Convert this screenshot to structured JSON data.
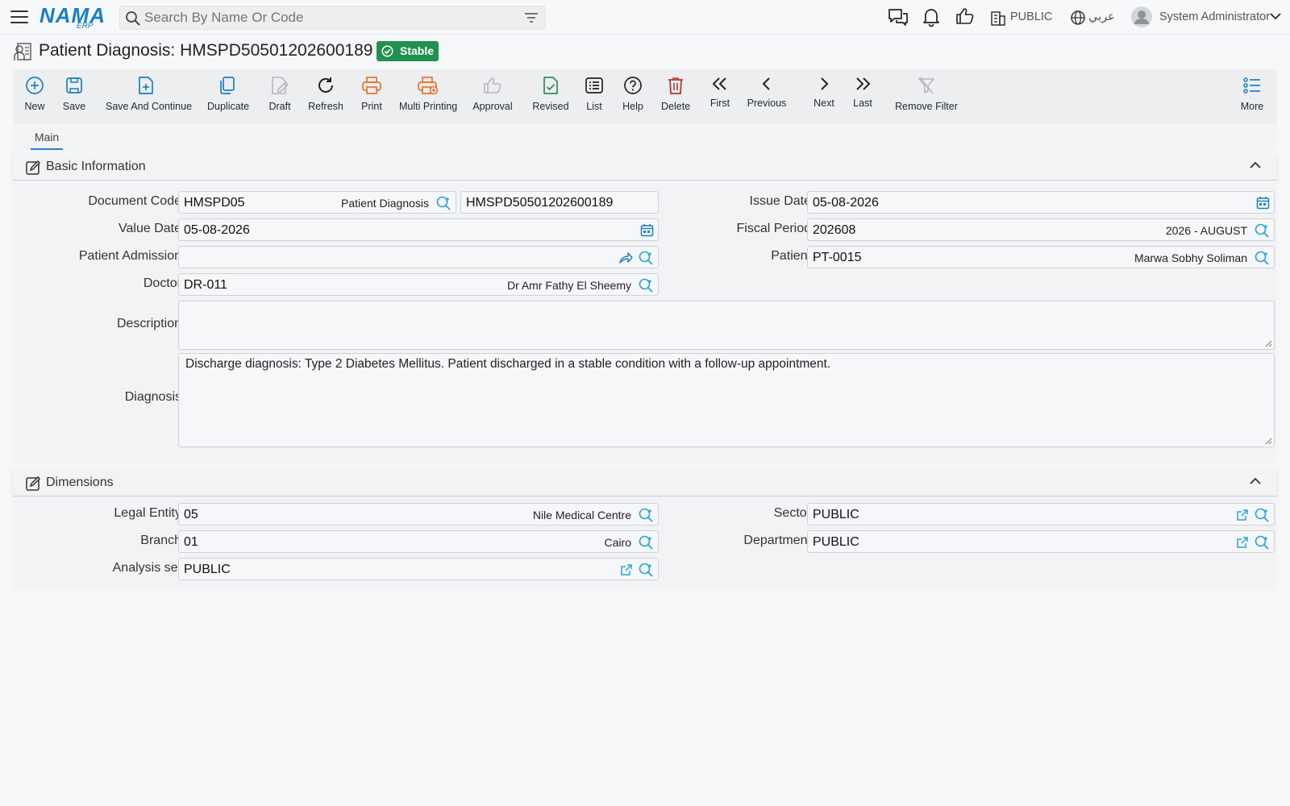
{
  "topbar": {
    "logo": "NAMA",
    "logo_sub": "ERP",
    "search_placeholder": "Search By Name Or Code",
    "company": "PUBLIC",
    "language": "عربي",
    "user": "System Administrator"
  },
  "header": {
    "title": "Patient Diagnosis: HMSPD50501202600189",
    "status": "Stable"
  },
  "toolbar": {
    "new": "New",
    "save": "Save",
    "save_continue": "Save And Continue",
    "duplicate": "Duplicate",
    "draft": "Draft",
    "refresh": "Refresh",
    "print": "Print",
    "multi_printing": "Multi Printing",
    "approval": "Approval",
    "revised": "Revised",
    "list": "List",
    "help": "Help",
    "delete": "Delete",
    "first": "First",
    "previous": "Previous",
    "next": "Next",
    "last": "Last",
    "remove_filter": "Remove Filter",
    "more": "More"
  },
  "tabs": {
    "main": "Main"
  },
  "basic": {
    "title": "Basic Information",
    "document_code_label": "Document Code",
    "document_code": "HMSPD05",
    "document_code_desc": "Patient Diagnosis",
    "document_number": "HMSPD50501202600189",
    "issue_date_label": "Issue Date",
    "issue_date": "05-08-2026",
    "value_date_label": "Value Date",
    "value_date": "05-08-2026",
    "fiscal_period_label": "Fiscal Period",
    "fiscal_period": "202608",
    "fiscal_period_desc": "2026 - AUGUST",
    "patient_admission_label": "Patient Admission",
    "patient_admission": "",
    "patient_label": "Patient",
    "patient": "PT-0015",
    "patient_desc": "Marwa Sobhy Soliman",
    "doctor_label": "Doctor",
    "doctor": "DR-011",
    "doctor_desc": "Dr Amr Fathy El Sheemy",
    "description_label": "Description",
    "description": "",
    "diagnosis_label": "Diagnosis",
    "diagnosis": "Discharge diagnosis: Type 2 Diabetes Mellitus. Patient discharged in a stable condition with a follow-up appointment."
  },
  "dimensions": {
    "title": "Dimensions",
    "legal_entity_label": "Legal Entity",
    "legal_entity": "05",
    "legal_entity_desc": "Nile Medical Centre",
    "sector_label": "Sector",
    "sector": "PUBLIC",
    "branch_label": "Branch",
    "branch": "01",
    "branch_desc": "Cairo",
    "department_label": "Department",
    "department": "PUBLIC",
    "analysis_set_label": "Analysis set",
    "analysis_set": "PUBLIC"
  },
  "colors": {
    "accent": "#1a7fc1",
    "status_green": "#21914f",
    "print_orange": "#e8722a",
    "delete_red": "#b03a2e",
    "revised_green": "#2e8b57"
  },
  "icons": [
    "menu-icon",
    "search-icon",
    "filter-icon",
    "chat-icon",
    "bell-icon",
    "thumbs-up-icon",
    "building-icon",
    "globe-icon",
    "avatar-icon",
    "chevron-down-icon"
  ]
}
